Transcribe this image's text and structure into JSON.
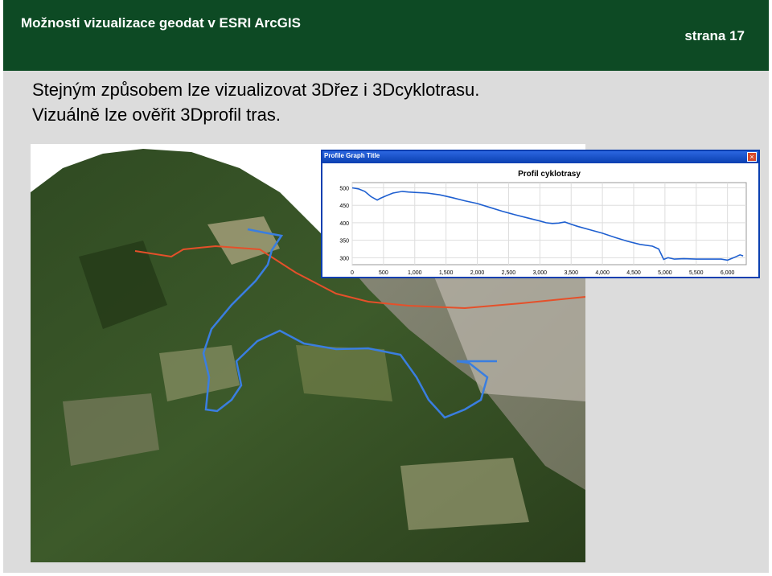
{
  "slide": {
    "header_title": "Možnosti vizualizace geodat v ESRI ArcGIS",
    "page_label": "strana 17",
    "line1": "Stejným způsobem lze vizualizovat 3Dřez i 3Dcyklotrasu.",
    "line2": "Vizuálně lze ověřit 3Dprofil tras."
  },
  "profile_window": {
    "window_title": "Profile Graph Title",
    "close_glyph": "×"
  },
  "chart_data": {
    "type": "line",
    "title": "Profil cyklotrasy",
    "xlabel": "",
    "ylabel": "",
    "x_ticks": [
      "0",
      "500",
      "1,000",
      "1,500",
      "2,000",
      "2,500",
      "3,000",
      "3,500",
      "4,000",
      "4,500",
      "5,000",
      "5,500",
      "6,000"
    ],
    "y_ticks": [
      "500",
      "450",
      "400",
      "350",
      "300"
    ],
    "xlim": [
      0,
      6300
    ],
    "ylim": [
      280,
      515
    ],
    "grid": true,
    "series": [
      {
        "color": "#1e5fd0",
        "x": [
          0,
          100,
          200,
          300,
          400,
          450,
          550,
          650,
          800,
          900,
          1000,
          1200,
          1400,
          1600,
          1800,
          2000,
          2200,
          2400,
          2600,
          2800,
          3000,
          3100,
          3200,
          3300,
          3400,
          3500,
          3600,
          3800,
          4000,
          4200,
          4400,
          4600,
          4800,
          4900,
          4980,
          5050,
          5150,
          5300,
          5500,
          5700,
          5900,
          6000,
          6100,
          6200,
          6250
        ],
        "y": [
          500,
          497,
          490,
          475,
          465,
          470,
          478,
          485,
          490,
          488,
          487,
          485,
          480,
          472,
          463,
          455,
          444,
          433,
          423,
          414,
          405,
          400,
          398,
          399,
          402,
          396,
          390,
          380,
          370,
          358,
          347,
          338,
          333,
          325,
          295,
          300,
          296,
          297,
          296,
          296,
          296,
          293,
          300,
          308,
          305
        ]
      }
    ]
  }
}
